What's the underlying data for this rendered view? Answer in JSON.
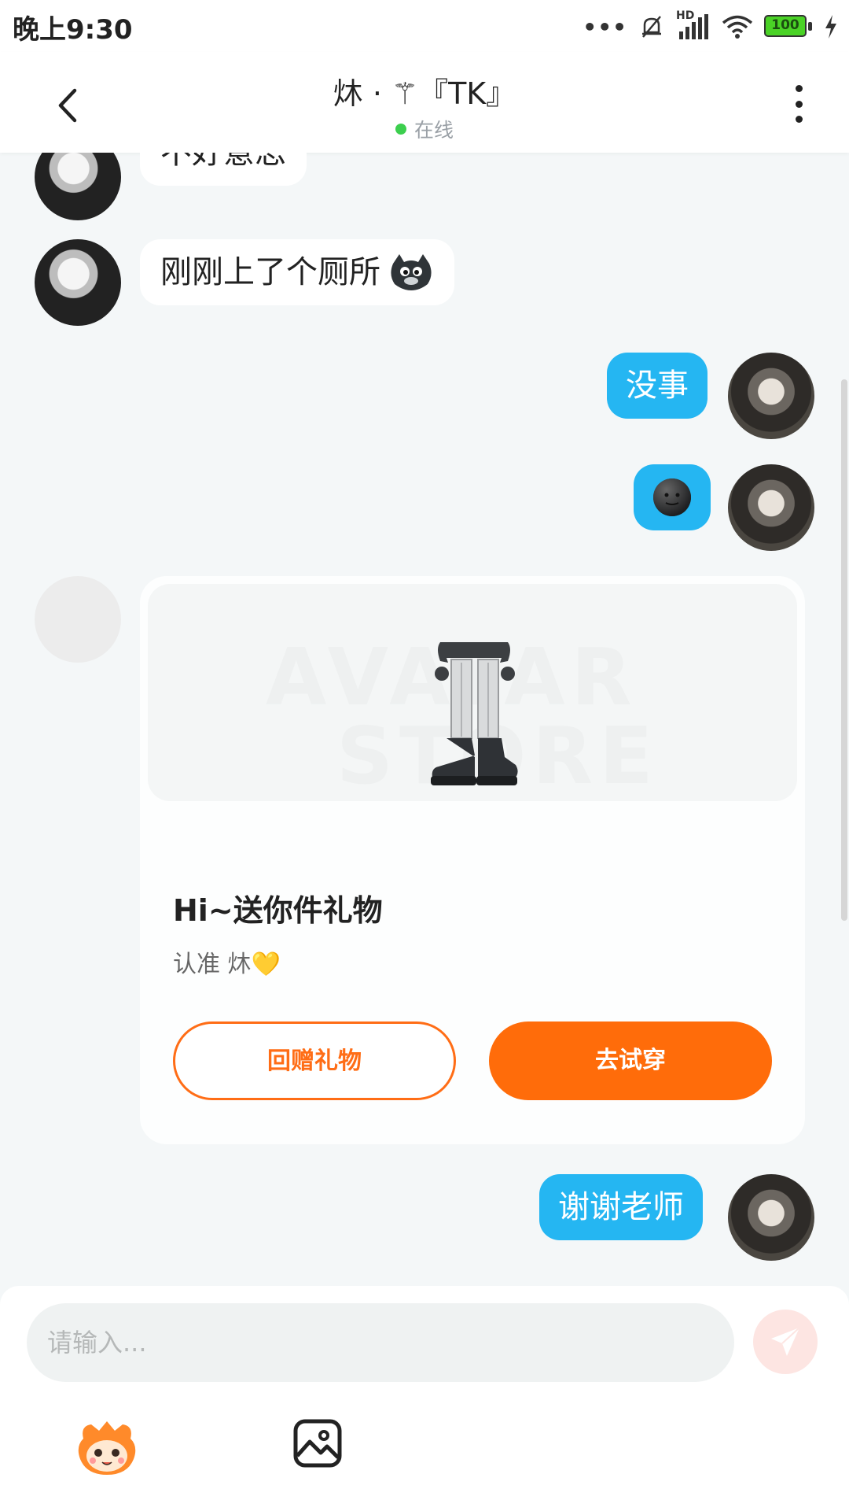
{
  "status_bar": {
    "time": "晚上9:30",
    "dots": "•••",
    "hd": "HD",
    "battery": "100"
  },
  "header": {
    "title": "炑 · ⚚『TK』",
    "status": "在线"
  },
  "messages": [
    {
      "side": "left",
      "text": "不好意思"
    },
    {
      "side": "left",
      "text": "刚刚上了个厕所",
      "emoji": "cat-emoji"
    },
    {
      "side": "right",
      "text": "没事"
    },
    {
      "side": "right",
      "emoji": "dark-face-emoji"
    },
    {
      "side": "right",
      "text": "谢谢老师"
    }
  ],
  "gift_card": {
    "watermark_1": "AVATAR",
    "watermark_2": "STORE",
    "title": "Hi~送你件礼物",
    "subtitle": "认准 炑💛",
    "return_gift_label": "回赠礼物",
    "try_on_label": "去试穿"
  },
  "composer": {
    "placeholder": "请输入..."
  },
  "colors": {
    "bubble_right": "#25b6f2",
    "accent_orange": "#ff6c0a",
    "online_green": "#3ccf4e",
    "background": "#f4f7f8"
  },
  "icons": [
    "back-arrow-icon",
    "more-vertical-icon",
    "send-icon",
    "emoji-mascot-icon",
    "image-icon"
  ]
}
